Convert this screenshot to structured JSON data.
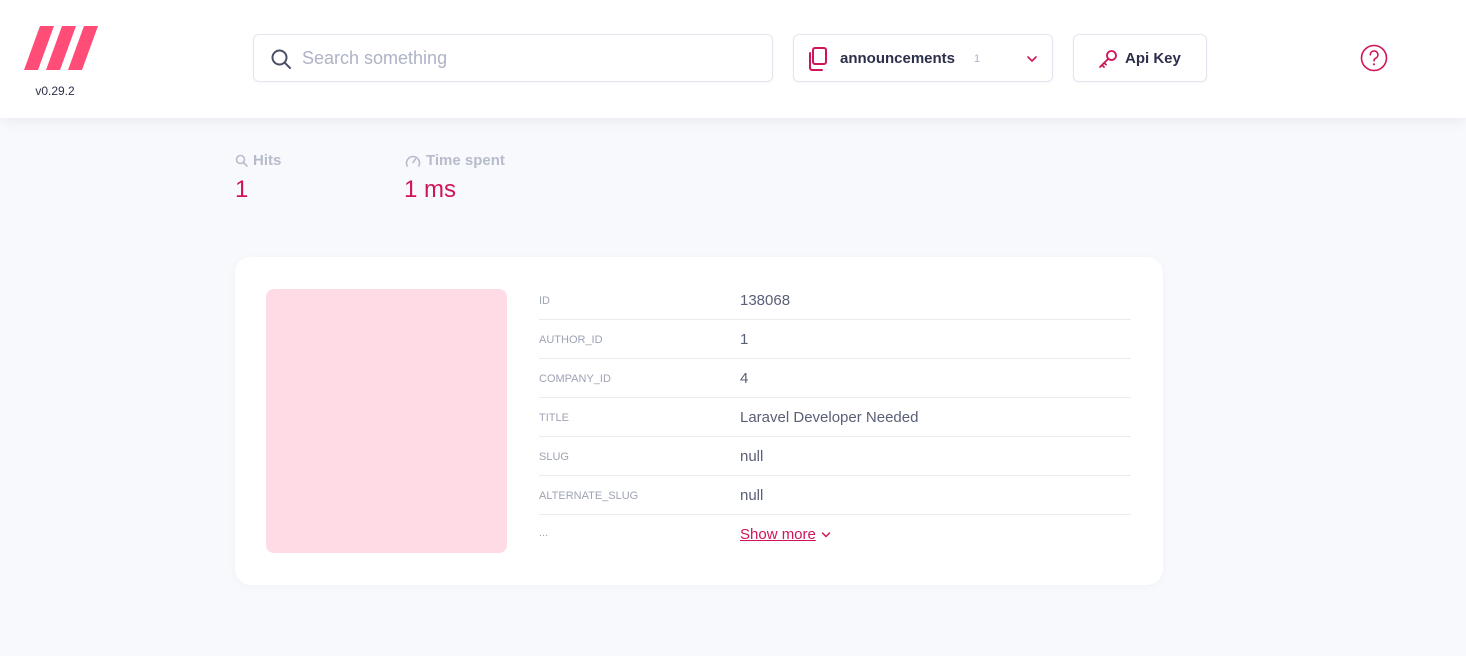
{
  "header": {
    "version": "v0.29.2",
    "search": {
      "placeholder": "Search something",
      "value": ""
    },
    "index_selector": {
      "name": "announcements",
      "count": "1"
    },
    "api_key_label": "Api Key"
  },
  "stats": {
    "hits": {
      "label": "Hits",
      "value": "1"
    },
    "time": {
      "label": "Time spent",
      "value": "1 ms"
    }
  },
  "result": {
    "fields": [
      {
        "key": "ID",
        "value": "138068"
      },
      {
        "key": "AUTHOR_ID",
        "value": "1"
      },
      {
        "key": "COMPANY_ID",
        "value": "4"
      },
      {
        "key": "TITLE",
        "value": "Laravel Developer Needed"
      },
      {
        "key": "SLUG",
        "value": "null"
      },
      {
        "key": "ALTERNATE_SLUG",
        "value": "null"
      }
    ],
    "more_key": "...",
    "show_more_label": "Show more"
  },
  "colors": {
    "accent": "#d0145a",
    "logo": "#ff4d78",
    "thumbnail": "#ffdbe6",
    "background": "#f8f9fd"
  }
}
